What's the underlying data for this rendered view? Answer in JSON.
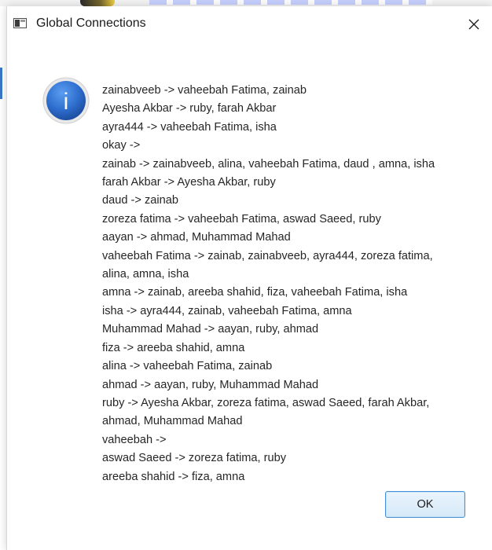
{
  "window": {
    "title": "Global Connections",
    "icon": "app-window-icon",
    "close_icon": "close-icon"
  },
  "message": {
    "icon": "info-icon",
    "icon_glyph": "i",
    "icon_color": "#2f6fcf",
    "lines": [
      "zainabveeb -> vaheebah Fatima, zainab",
      "Ayesha Akbar -> ruby, farah Akbar",
      "ayra444 -> vaheebah Fatima, isha",
      "okay ->",
      "zainab -> zainabveeb, alina, vaheebah Fatima, daud , amna, isha",
      "farah Akbar -> Ayesha Akbar, ruby",
      "daud  -> zainab",
      "zoreza fatima -> vaheebah Fatima, aswad Saeed, ruby",
      "aayan -> ahmad, Muhammad Mahad",
      "vaheebah Fatima -> zainab, zainabveeb, ayra444, zoreza fatima,",
      "alina, amna, isha",
      "amna -> zainab, areeba shahid, fiza, vaheebah Fatima, isha",
      "isha -> ayra444, zainab, vaheebah Fatima, amna",
      "Muhammad Mahad -> aayan, ruby, ahmad",
      "fiza -> areeba shahid, amna",
      "alina -> vaheebah Fatima, zainab",
      "ahmad -> aayan, ruby, Muhammad Mahad",
      "ruby -> Ayesha Akbar, zoreza fatima, aswad Saeed, farah Akbar,",
      "ahmad, Muhammad Mahad",
      "vaheebah ->",
      "aswad Saeed -> zoreza fatima, ruby",
      "areeba shahid -> fiza, amna"
    ]
  },
  "buttons": {
    "ok_label": "OK"
  }
}
